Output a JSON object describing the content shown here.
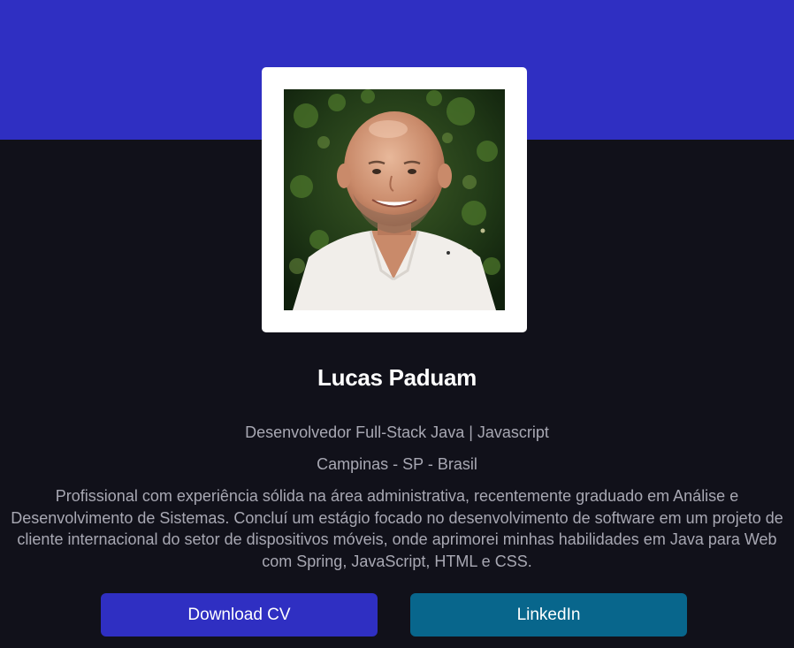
{
  "profile": {
    "name": "Lucas Paduam",
    "role": "Desenvolvedor Full-Stack Java | Javascript",
    "location": "Campinas - SP - Brasil",
    "bio": "Profissional com experiência sólida na área administrativa, recentemente graduado em Análise e Desenvolvimento de Sistemas. Concluí um estágio focado no desenvolvimento de software em um projeto de cliente internacional do setor de dispositivos móveis, onde aprimorei minhas habilidades em Java para Web com Spring, JavaScript, HTML e CSS."
  },
  "actions": {
    "download_cv_label": "Download CV",
    "linkedin_label": "LinkedIn"
  },
  "colors": {
    "banner": "#2f2fc2",
    "background": "#11111a",
    "download_button": "#2f2fc2",
    "linkedin_button": "#08668c",
    "text_muted": "#a8a8b3"
  }
}
